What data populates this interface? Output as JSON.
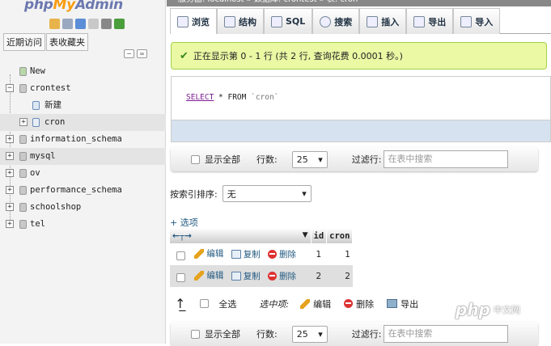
{
  "brand": {
    "php": "php",
    "my": "My",
    "admin": "Admin"
  },
  "nav_tabs": [
    "近期访问",
    "表收藏夹"
  ],
  "tree": [
    {
      "label": "New"
    },
    {
      "label": "crontest"
    },
    {
      "label": "新建"
    },
    {
      "label": "cron"
    },
    {
      "label": "information_schema"
    },
    {
      "label": "mysql"
    },
    {
      "label": "ov"
    },
    {
      "label": "performance_schema"
    },
    {
      "label": "schoolshop"
    },
    {
      "label": "tel"
    }
  ],
  "breadcrumb": "服务器: localhost  »  数据库: crontest  »  表: cron",
  "tabs": [
    "浏览",
    "结构",
    "SQL",
    "搜索",
    "插入",
    "导出",
    "导入"
  ],
  "message": "正在显示第 0 - 1 行 (共 2 行, 查询花费 0.0001 秒。)",
  "sql": {
    "select": "SELECT",
    "rest": " * FROM ",
    "table": "`cron`"
  },
  "navbar": {
    "show_all": "显示全部",
    "rows_label": "行数:",
    "rows_value": "25",
    "filter_label": "过滤行:",
    "filter_placeholder": "在表中搜索"
  },
  "sort": {
    "label": "按索引排序:",
    "value": "无"
  },
  "options_label": "+ 选项",
  "table": {
    "columns": [
      "id",
      "cron"
    ],
    "rows": [
      {
        "id": "1",
        "cron": "1"
      },
      {
        "id": "2",
        "cron": "2"
      }
    ],
    "actions": {
      "edit": "编辑",
      "copy": "复制",
      "delete": "删除"
    }
  },
  "bulk": {
    "select_all": "全选",
    "selected": "选中项:",
    "edit": "编辑",
    "delete": "删除",
    "export": "导出"
  },
  "watermark": {
    "php": "php",
    "cn": "中文网"
  }
}
